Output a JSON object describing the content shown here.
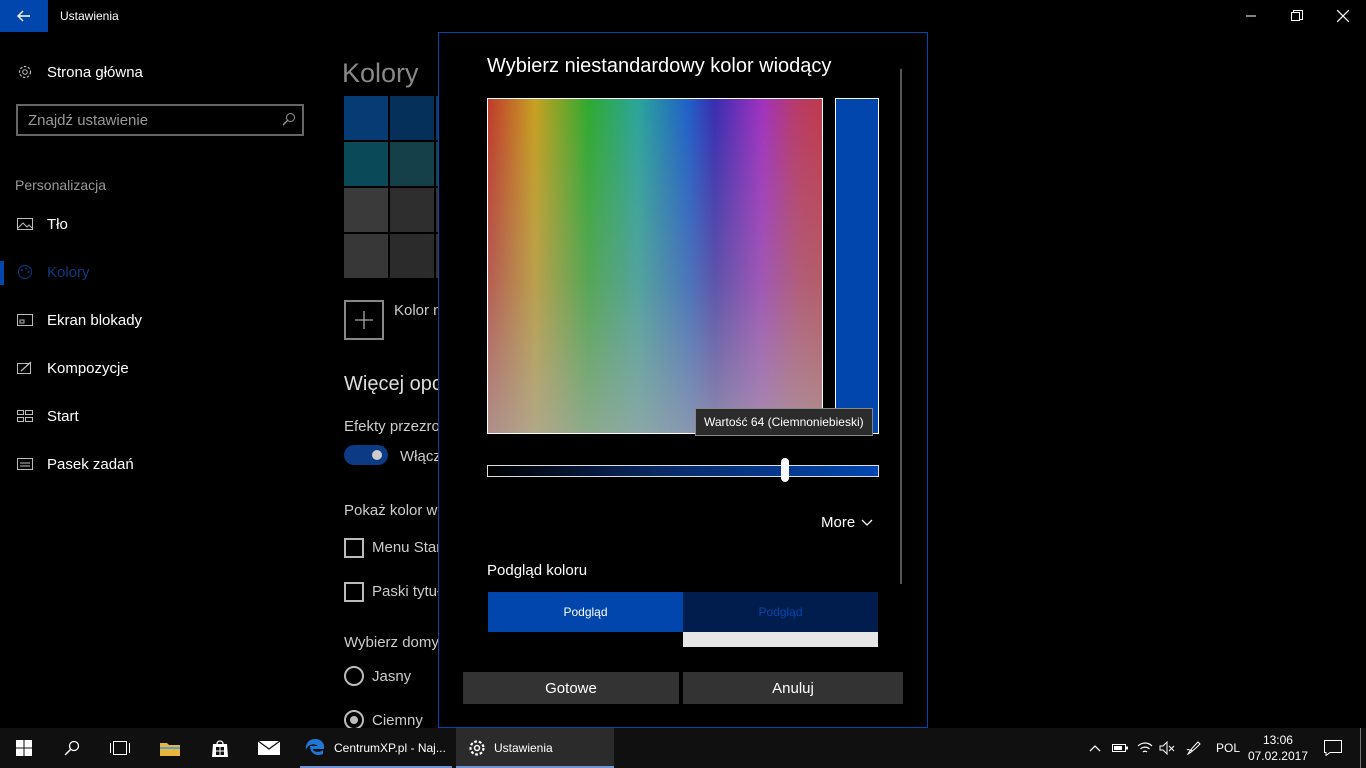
{
  "window": {
    "title": "Ustawienia"
  },
  "sidebar": {
    "home_label": "Strona główna",
    "search_placeholder": "Znajdź ustawienie",
    "section_label": "Personalizacja",
    "items": [
      {
        "label": "Tło",
        "icon": "picture-icon"
      },
      {
        "label": "Kolory",
        "icon": "palette-icon",
        "active": true
      },
      {
        "label": "Ekran blokady",
        "icon": "lock-screen-icon"
      },
      {
        "label": "Kompozycje",
        "icon": "themes-icon"
      },
      {
        "label": "Start",
        "icon": "start-icon"
      },
      {
        "label": "Pasek zadań",
        "icon": "taskbar-icon"
      }
    ]
  },
  "main": {
    "title": "Kolory",
    "custom_color_label": "Kolor n",
    "more_options_heading": "Więcej opc",
    "transparency_label": "Efekty przezro",
    "toggle_label": "Włącz",
    "show_color_label": "Pokaż kolor wi",
    "checkbox_start": "Menu Star",
    "checkbox_titlebars": "Paski tytuł",
    "app_mode_label": "Wybierz domy",
    "radio_light": "Jasny",
    "radio_dark": "Ciemny"
  },
  "dialog": {
    "title": "Wybierz niestandardowy kolor wiodący",
    "tooltip": "Wartość 64 (Ciemnoniebieski)",
    "slider_value": 64,
    "more_label": "More",
    "preview_label": "Podgląd koloru",
    "preview_light": "Podgląd",
    "preview_dark": "Podgląd",
    "ok_button": "Gotowe",
    "cancel_button": "Anuluj",
    "accent_color": "#0046ad"
  },
  "taskbar": {
    "apps": [
      {
        "label": "CentrumXP.pl - Naj...",
        "icon": "edge-icon"
      },
      {
        "label": "Ustawienia",
        "icon": "gear-icon"
      }
    ],
    "language": "POL",
    "time": "13:06",
    "date": "07.02.2017"
  }
}
